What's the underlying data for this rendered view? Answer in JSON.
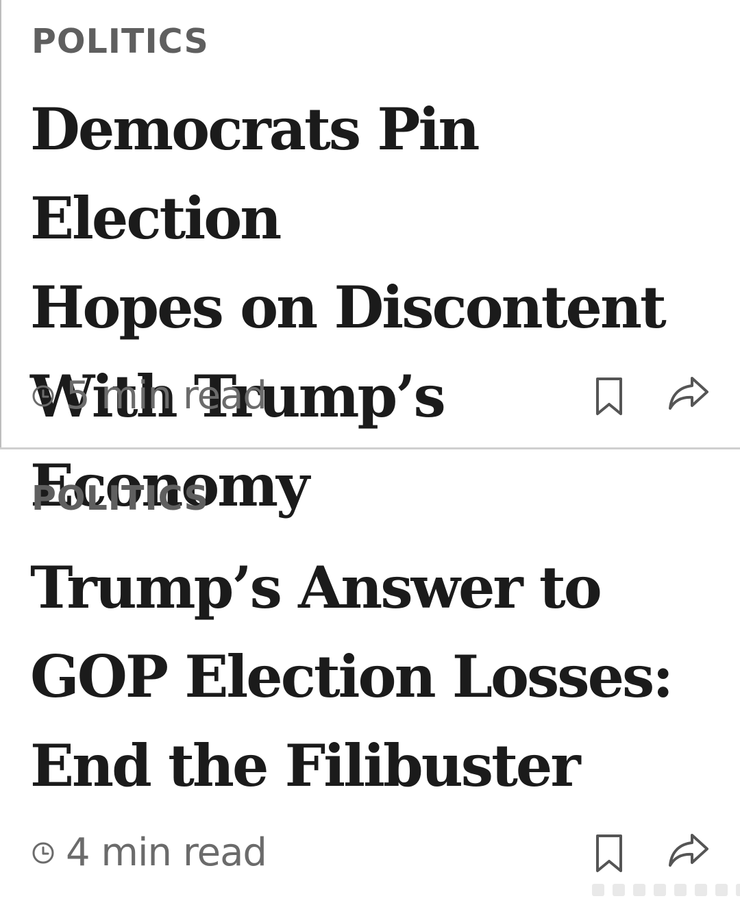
{
  "articles": [
    {
      "section": "POLITICS",
      "headline_lines": [
        "Democrats Pin Election",
        "Hopes on Discontent",
        "With Trump’s Economy"
      ],
      "read_time": "5 min read",
      "icons": {
        "clock": "clock-icon",
        "bookmark": "bookmark-icon",
        "share": "share-icon"
      }
    },
    {
      "section": "POLITICS",
      "headline_lines": [
        "Trump’s Answer to",
        "GOP Election Losses:",
        "End the Filibuster"
      ],
      "read_time": "4 min read",
      "icons": {
        "clock": "clock-icon",
        "bookmark": "bookmark-icon",
        "share": "share-icon"
      }
    }
  ],
  "colors": {
    "headline": "#1b1b1b",
    "section_label": "#5f5f5f",
    "meta_text": "#6b6b6b",
    "divider": "#cfcfcf"
  }
}
